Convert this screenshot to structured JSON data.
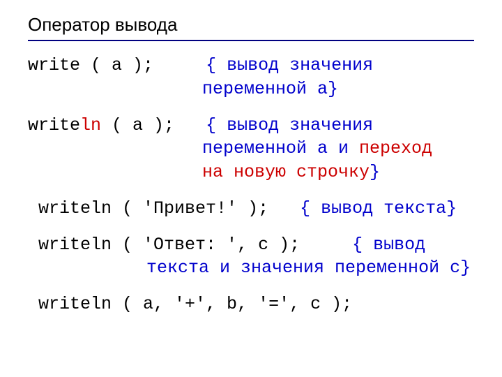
{
  "title": "Оператор вывода",
  "lines": {
    "l1": {
      "code": "write ( a );",
      "comment_open": "{ ",
      "c1": "вывод значения",
      "c2": "переменной a",
      "comment_close": "}"
    },
    "l2": {
      "code_pre": "write",
      "code_red": "ln",
      "code_post": " ( a );",
      "comment_open": "{ ",
      "c1": "вывод значения",
      "c2a": "переменной a и ",
      "c2b_red": "переход",
      "c3_red": "на новую строчку",
      "comment_close": "}"
    },
    "l3": {
      "code": "writeln ( 'Привет!' );",
      "comment_open": "{ ",
      "c1": "вывод текста",
      "comment_close": "}"
    },
    "l4": {
      "code": "writeln ( 'Ответ: ', c );",
      "comment_open": "{ ",
      "c1": "вывод",
      "c2": "текста и значения переменной c",
      "comment_close": "}"
    },
    "l5": {
      "code": "writeln ( a, '+', b, '=', c );"
    }
  }
}
